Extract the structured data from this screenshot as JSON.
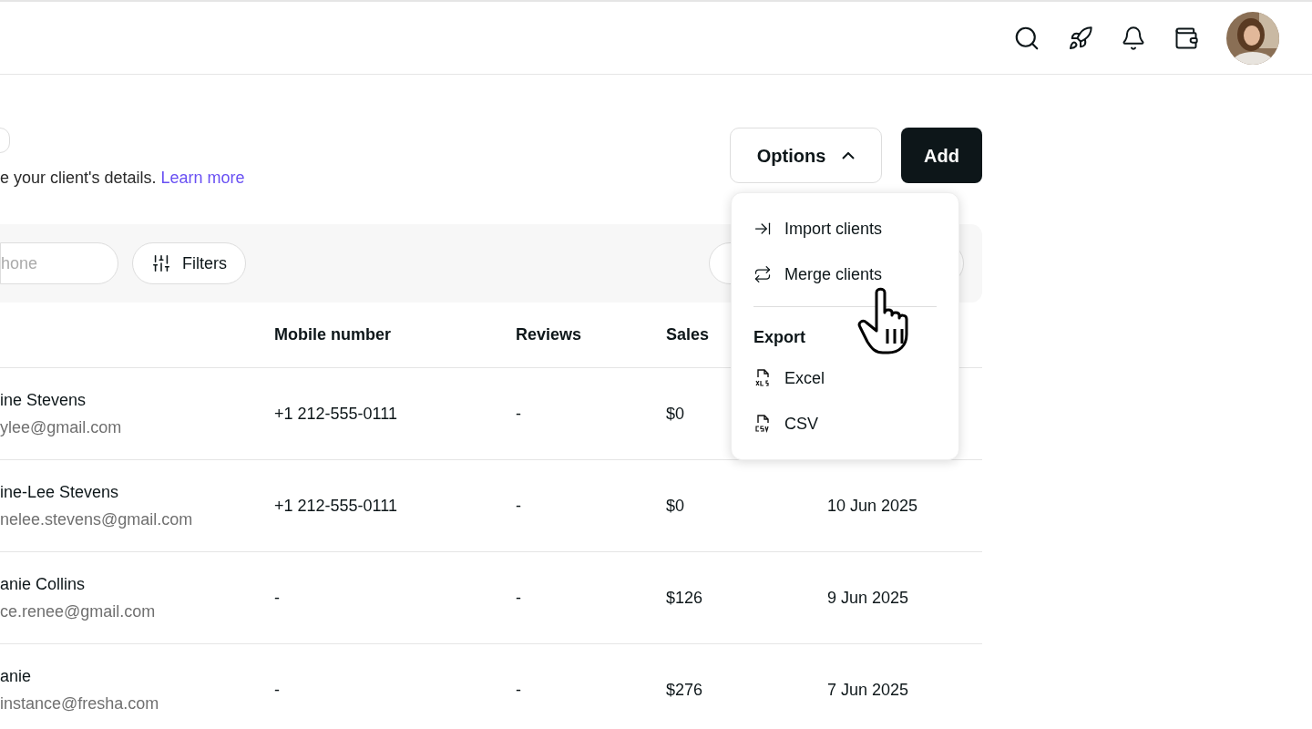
{
  "header": {
    "description": "e your client's details.",
    "link": "Learn more"
  },
  "actions": {
    "options": "Options",
    "options_expanded": true,
    "add": "Add"
  },
  "toolbar": {
    "search_placeholder": "hone",
    "filters": "Filters"
  },
  "table": {
    "columns": [
      "Mobile number",
      "Reviews",
      "Sales"
    ],
    "rows": [
      {
        "name": "ine Stevens",
        "email": "ylee@gmail.com",
        "mobile": "+1 212-555-0111",
        "reviews": "-",
        "sales": "$0"
      },
      {
        "name": "ine-Lee Stevens",
        "email": "nelee.stevens@gmail.com",
        "mobile": "+1 212-555-0111",
        "reviews": "-",
        "sales": "$0",
        "date": "10 Jun 2025"
      },
      {
        "name": "anie Collins",
        "email": "ce.renee@gmail.com",
        "mobile": "-",
        "reviews": "-",
        "sales": "$126",
        "date": "9 Jun 2025"
      },
      {
        "name": "anie",
        "email": "instance@fresha.com",
        "mobile": "-",
        "reviews": "-",
        "sales": "$276",
        "date": "7 Jun 2025"
      }
    ]
  },
  "menu": {
    "items": [
      {
        "kind": "import",
        "label": "Import clients"
      },
      {
        "kind": "merge",
        "label": "Merge clients"
      },
      {
        "kind": "section",
        "label": "Export"
      },
      {
        "kind": "xls",
        "label": "Excel"
      },
      {
        "kind": "csv",
        "label": "CSV"
      }
    ]
  }
}
